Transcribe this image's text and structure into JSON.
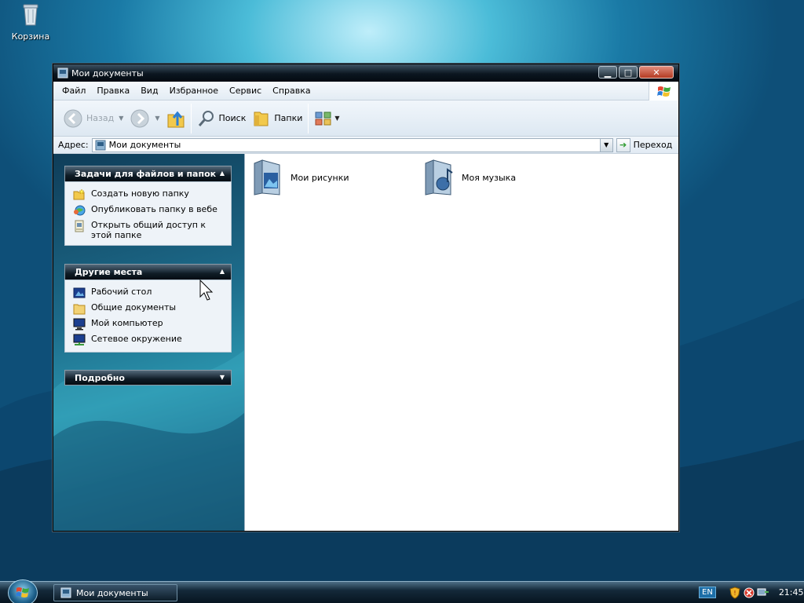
{
  "desktop": {
    "icons": [
      {
        "label": "Корзина",
        "icon": "recycle-bin-icon"
      }
    ]
  },
  "window": {
    "title": "Мои документы",
    "menu": [
      "Файл",
      "Правка",
      "Вид",
      "Избранное",
      "Сервис",
      "Справка"
    ],
    "toolbar": {
      "back_label": "Назад",
      "search_label": "Поиск",
      "folders_label": "Папки"
    },
    "address": {
      "label": "Адрес:",
      "value": "Мои документы",
      "go_label": "Переход"
    },
    "tasks_panel": {
      "title": "Задачи для файлов и папок",
      "items": [
        {
          "label": "Создать новую папку",
          "icon": "new-folder-icon"
        },
        {
          "label": "Опубликовать папку в вебе",
          "icon": "web-publish-icon"
        },
        {
          "label": "Открыть общий доступ к этой папке",
          "icon": "share-folder-icon"
        }
      ]
    },
    "places_panel": {
      "title": "Другие места",
      "items": [
        {
          "label": "Рабочий стол",
          "icon": "desktop-icon"
        },
        {
          "label": "Общие документы",
          "icon": "shared-documents-icon"
        },
        {
          "label": "Мой компьютер",
          "icon": "my-computer-icon"
        },
        {
          "label": "Сетевое окружение",
          "icon": "network-places-icon"
        }
      ]
    },
    "details_panel": {
      "title": "Подробно"
    },
    "files": [
      {
        "label": "Мои рисунки",
        "icon": "my-pictures-folder-icon"
      },
      {
        "label": "Моя музыка",
        "icon": "my-music-folder-icon"
      }
    ]
  },
  "taskbar": {
    "task_label": "Мои документы",
    "lang": "EN",
    "clock": "21:45"
  }
}
